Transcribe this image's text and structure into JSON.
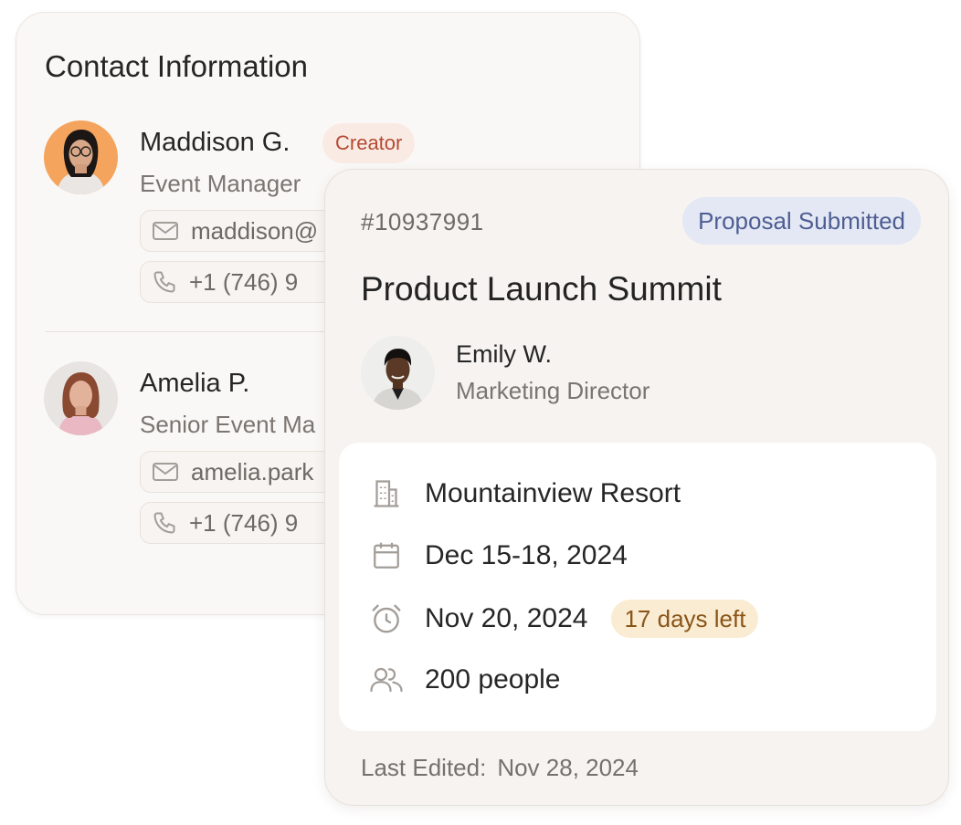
{
  "contacts": {
    "title": "Contact Information",
    "people": [
      {
        "name": "Maddison G.",
        "badge": "Creator",
        "role": "Event Manager",
        "email": "maddison@",
        "phone": "+1 (746) 9"
      },
      {
        "name": "Amelia P.",
        "role": "Senior Event Ma",
        "email": "amelia.park",
        "phone": "+1 (746) 9"
      }
    ]
  },
  "event": {
    "id": "#10937991",
    "status": "Proposal Submitted",
    "title": "Product Launch Summit",
    "host": {
      "name": "Emily W.",
      "role": "Marketing Director"
    },
    "details": {
      "venue": "Mountainview Resort",
      "dates": "Dec 15-18, 2024",
      "deadline": "Nov 20, 2024",
      "days_left": "17 days left",
      "attendees": "200 people"
    },
    "last_edited_label": "Last Edited:",
    "last_edited_value": "Nov 28, 2024"
  },
  "colors": {
    "creator_badge_bg": "#f9ebe4",
    "creator_badge_text": "#b54a33",
    "status_badge_bg": "#e4e8f4",
    "status_badge_text": "#4e5e93",
    "days_badge_bg": "#f9ecd2",
    "days_badge_text": "#8a5418",
    "icon_gray": "#a39d98"
  }
}
